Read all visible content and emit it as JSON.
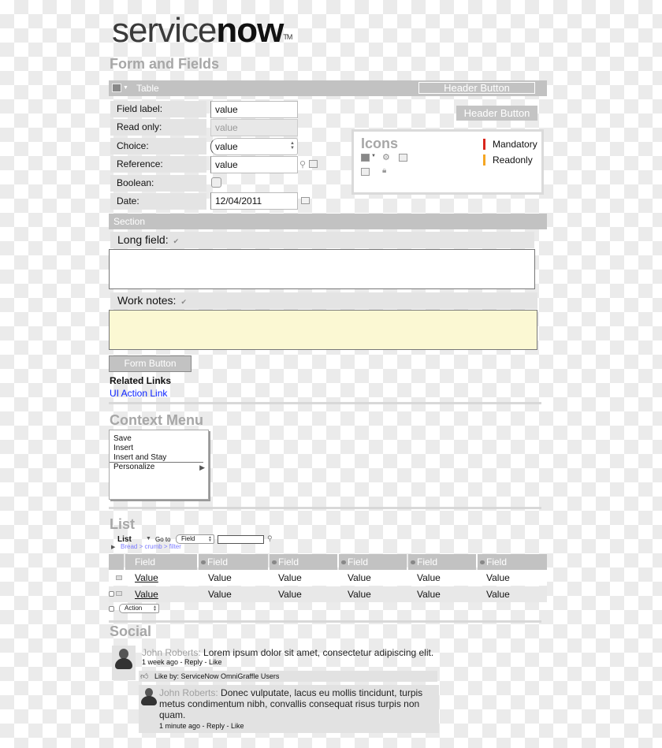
{
  "brand": {
    "logo_light": "service",
    "logo_bold": "now",
    "logo_tm": "TM"
  },
  "form_section": {
    "title": "Form and Fields",
    "table_label": "Table",
    "header_button_1": "Header Button",
    "header_button_2": "Header Button",
    "fields": [
      {
        "label": "Field label:",
        "value": "value",
        "type": "text"
      },
      {
        "label": "Read only:",
        "value": "value",
        "type": "readonly"
      },
      {
        "label": "Choice:",
        "value": "value",
        "type": "choice"
      },
      {
        "label": "Reference:",
        "value": "value",
        "type": "reference"
      },
      {
        "label": "Boolean:",
        "value": "",
        "type": "checkbox"
      },
      {
        "label": "Date:",
        "value": "12/04/2011",
        "type": "date"
      }
    ],
    "icons_panel": {
      "title": "Icons",
      "icons": [
        "context-menu-icon",
        "personalize-icon",
        "reference-info-icon",
        "calendar-icon",
        "lock-icon"
      ],
      "legend": [
        {
          "label": "Mandatory",
          "color": "#d9261c"
        },
        {
          "label": "Readonly",
          "color": "#f5a623"
        }
      ]
    },
    "section_label": "Section",
    "long_field_label": "Long field:",
    "long_field_value": "",
    "work_notes_label": "Work notes:",
    "work_notes_value": "",
    "form_button": "Form Button",
    "related_links_title": "Related Links",
    "ui_action_link": "UI Action Link"
  },
  "context_menu": {
    "title": "Context Menu",
    "items": [
      "Save",
      "Insert",
      "Insert and Stay",
      "Personalize"
    ],
    "submenu_arrow": "▶"
  },
  "list": {
    "title": "List",
    "list_label": "List",
    "goto_label": "Go to",
    "goto_field": "Field",
    "goto_query": "",
    "breadcrumb": "Bread > crumb > filter",
    "columns": [
      "Field",
      "Field",
      "Field",
      "Field",
      "Field",
      "Field"
    ],
    "rows": [
      [
        "Value",
        "Value",
        "Value",
        "Value",
        "Value",
        "Value"
      ],
      [
        "Value",
        "Value",
        "Value",
        "Value",
        "Value",
        "Value"
      ]
    ],
    "action_select": "Action"
  },
  "social": {
    "title": "Social",
    "post": {
      "author": "John Roberts:",
      "text": " Lorem ipsum dolor sit amet, consectetur adipiscing elit.",
      "meta": "1 week ago - Reply - Like"
    },
    "likes": "Like by: ServiceNow OmniGraffle Users",
    "reply": {
      "author": "John Roberts:",
      "text": " Donec vulputate, lacus eu mollis tincidunt, turpis metus condimentum nibh, convallis consequat risus turpis non quam.",
      "meta": "1 minute ago - Reply - Like"
    }
  }
}
